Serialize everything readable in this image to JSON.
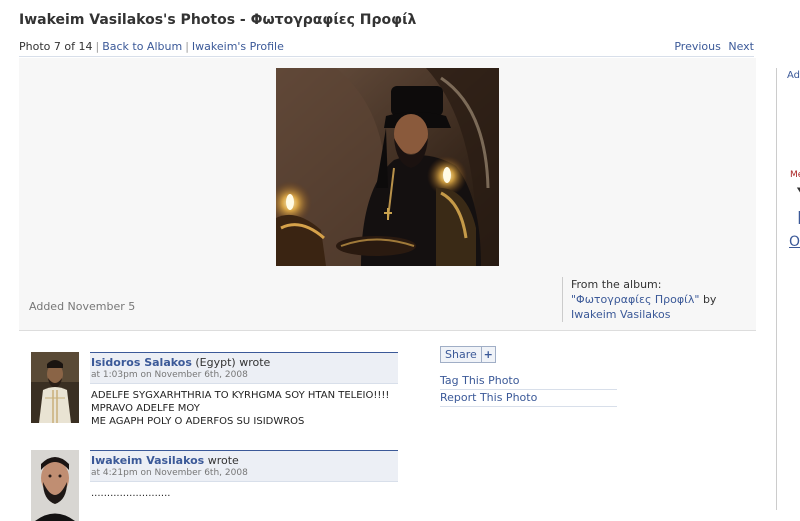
{
  "page": {
    "title": "Iwakeim Vasilakos's Photos - Φωτογραφίες Προφίλ"
  },
  "subnav": {
    "photo_count": "Photo 7 of 14",
    "back_to_album": "Back to Album",
    "profile_link": "Iwakeim's Profile",
    "previous": "Previous",
    "next": "Next"
  },
  "photo": {
    "added": "Added November 5",
    "album_prefix": "From the album:",
    "album_name": "\"Φωτογραφίες Προφίλ\"",
    "by": "by",
    "owner": "Iwakeim Vasilakos"
  },
  "comments": [
    {
      "author": "Isidoros Salakos",
      "location": "(Egypt)",
      "wrote": "wrote",
      "time": "at 1:03pm on November 6th, 2008",
      "lines": [
        "ADELFE SYGXARHTHRIA TO KYRHGMA SOY HTAN TELEIO!!!!",
        "MPRAVO ADELFE MOY",
        "ME AGAPH POLY O ADERFOS SU ISIDWROS"
      ]
    },
    {
      "author": "Iwakeim Vasilakos",
      "location": "",
      "wrote": "wrote",
      "time": "at 4:21pm on November 6th, 2008",
      "lines": [
        "........................."
      ]
    }
  ],
  "actions": {
    "share": "Share",
    "share_plus": "+",
    "tag": "Tag This Photo",
    "report": "Report This Photo"
  },
  "right_column": {
    "item1": "Ad",
    "item2": "Me",
    "item3": "Y",
    "item4": "I",
    "item5": "O"
  }
}
